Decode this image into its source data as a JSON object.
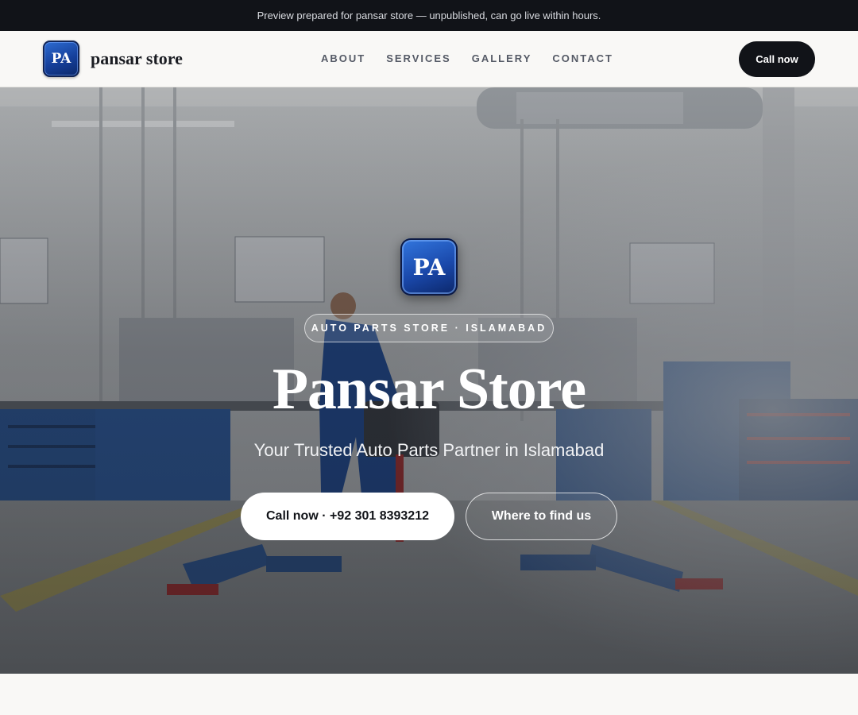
{
  "banner": {
    "text": "Preview prepared for pansar store — unpublished, can go live within hours."
  },
  "nav": {
    "logo_text": "PA",
    "brand": "pansar store",
    "links": [
      {
        "label": "ABOUT"
      },
      {
        "label": "SERVICES"
      },
      {
        "label": "GALLERY"
      },
      {
        "label": "CONTACT"
      }
    ],
    "cta": "Call now"
  },
  "hero": {
    "logo_text": "PA",
    "pill": "AUTO PARTS STORE · ISLAMABAD",
    "title": "Pansar Store",
    "subtitle": "Your Trusted Auto Parts Partner in Islamabad",
    "primary_button": "Call now · +92 301 8393212",
    "secondary_button": "Where to find us",
    "background": "workshop-photo"
  },
  "colors": {
    "dark": "#111318",
    "page_bg": "#f9f8f6",
    "logo_blue": "#1a48aa",
    "nav_text": "#555a66"
  }
}
